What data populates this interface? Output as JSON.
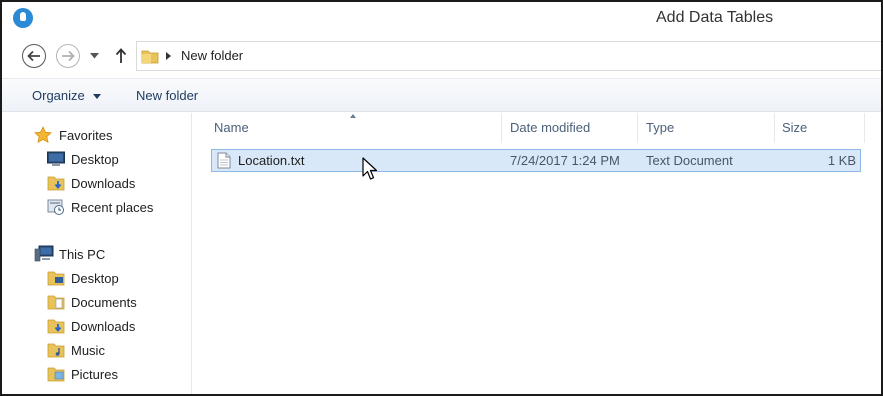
{
  "window": {
    "title": "Add Data Tables"
  },
  "address_bar": {
    "folder": "New folder"
  },
  "toolbar": {
    "organize": "Organize",
    "new_folder": "New folder"
  },
  "nav_pane": {
    "favorites": {
      "label": "Favorites",
      "items": [
        {
          "label": "Desktop",
          "icon": "desktop-icon"
        },
        {
          "label": "Downloads",
          "icon": "downloads-folder-icon"
        },
        {
          "label": "Recent places",
          "icon": "recent-places-icon"
        }
      ]
    },
    "this_pc": {
      "label": "This PC",
      "items": [
        {
          "label": "Desktop",
          "icon": "desktop-folder-icon"
        },
        {
          "label": "Documents",
          "icon": "documents-folder-icon"
        },
        {
          "label": "Downloads",
          "icon": "downloads-folder-icon"
        },
        {
          "label": "Music",
          "icon": "music-folder-icon"
        },
        {
          "label": "Pictures",
          "icon": "pictures-folder-icon"
        }
      ]
    }
  },
  "columns": {
    "name": "Name",
    "date_modified": "Date modified",
    "type": "Type",
    "size": "Size"
  },
  "files": [
    {
      "name": "Location.txt",
      "date_modified": "7/24/2017 1:24 PM",
      "type": "Text Document",
      "size": "1 KB",
      "selected": true
    }
  ],
  "colors": {
    "selection_bg": "#d8e8f8",
    "selection_border": "#8fb8e6",
    "accent": "#2b8ad6"
  }
}
